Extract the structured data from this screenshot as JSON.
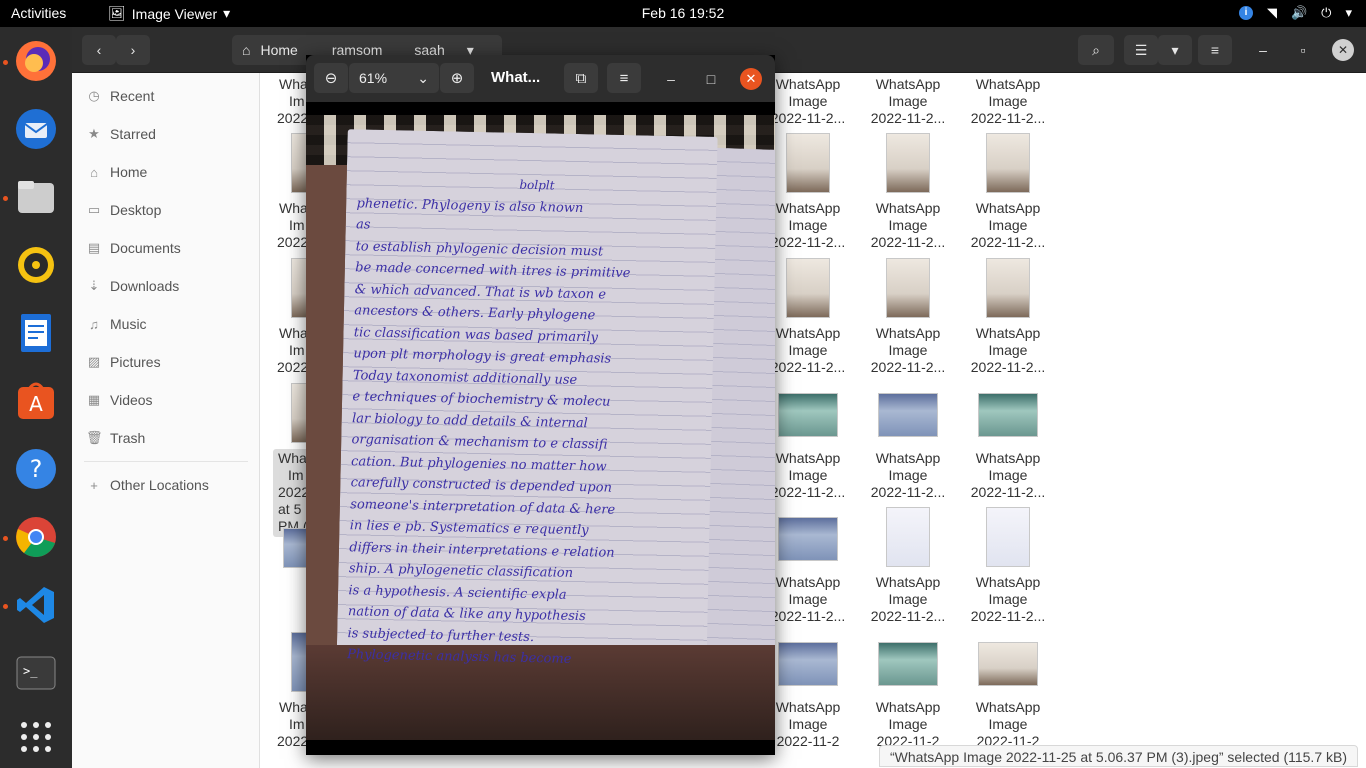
{
  "topbar": {
    "activities": "Activities",
    "app_name": "Image Viewer",
    "clock": "Feb 16  19:52"
  },
  "dock": {
    "items": [
      {
        "name": "firefox-icon"
      },
      {
        "name": "thunderbird-icon"
      },
      {
        "name": "files-icon"
      },
      {
        "name": "rhythmbox-icon"
      },
      {
        "name": "writer-icon"
      },
      {
        "name": "software-icon"
      },
      {
        "name": "help-icon"
      },
      {
        "name": "chrome-icon"
      },
      {
        "name": "vscode-icon"
      },
      {
        "name": "terminal-icon"
      },
      {
        "name": "show-apps-icon"
      }
    ]
  },
  "files": {
    "breadcrumb": [
      "Home",
      "ramsom",
      "saah"
    ],
    "sidebar": [
      "Recent",
      "Starred",
      "Home",
      "Desktop",
      "Documents",
      "Downloads",
      "Music",
      "Pictures",
      "Videos",
      "Trash",
      "Other Locations"
    ],
    "left_column_labels": [
      "Wha",
      "Im",
      "2022"
    ],
    "selected_label": [
      "Wha",
      "Im",
      "2022",
      "at 5",
      "PM ("
    ],
    "rows": [
      [
        "2022-11-1...",
        "2022-11-1...",
        "2022-11-2...",
        "2022-11-2...",
        "2022-11-2...",
        "2022-11-2..."
      ],
      [
        "2022-11-2...",
        "2022-11-2...",
        "2022-11-2...",
        "2022-11-2...",
        "2022-11-2...",
        "2022-11-2..."
      ],
      [
        "2022-11-2...",
        "2022-11-2...",
        "2022-11-2...",
        "2022-11-2...",
        "2022-11-2...",
        "2022-11-2..."
      ],
      [
        "2022-11-2...",
        "2022-11-2...",
        "2022-11-2...",
        "2022-11-2...",
        "2022-11-2...",
        "2022-11-2..."
      ],
      [
        "2022-11-2...",
        "2022-11-2...",
        "2022-11-2...",
        "2022-11-2...",
        "2022-11-2...",
        "2022-11-2..."
      ],
      [
        "2022-11-2...",
        "2022-11-2",
        "2022-11-2",
        "2022-11-2",
        "2022-11-2",
        "2022-11-2"
      ]
    ],
    "name_line1": "WhatsApp",
    "name_line2": "Image",
    "status": "“WhatsApp Image 2022-11-25 at 5.06.37 PM (3).jpeg” selected  (115.7 kB)"
  },
  "viewer": {
    "zoom": "61%",
    "title": "What...",
    "note_lines": [
      "bolplt",
      "phenetic. Phylogeny is also known",
      "as",
      "to establish phylogenic decision must",
      "be made concerned with itres is primitive",
      "& which advanced. That is wb taxon e",
      "ancestors & others. Early phylogene",
      "tic classification was based primarily",
      "upon plt morphology is great emphasis",
      "Today taxonomist additionally use",
      "e techniques of biochemistry & molecu",
      "lar biology to add details & internal",
      "organisation & mechanism to e classifi",
      "cation. But phylogenies no matter how",
      "carefully constructed is depended upon",
      "someone's interpretation of data & here",
      "in lies e pb. Systematics e requently",
      "differs in their interpretations e relation",
      "ship. A phylogenetic classification",
      "is a hypothesis. A scientific expla",
      "nation of data & like any hypothesis",
      "is subjected to further tests.",
      "Phylogenetic analysis has become"
    ]
  }
}
